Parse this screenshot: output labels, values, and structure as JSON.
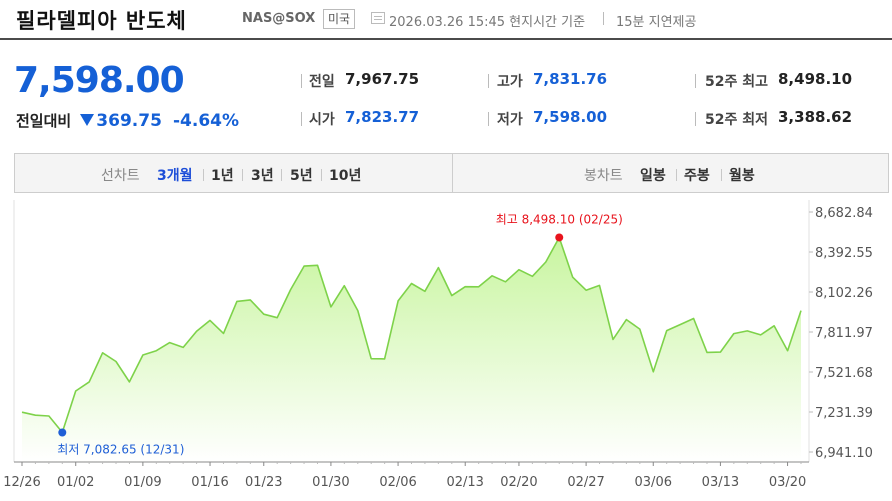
{
  "header": {
    "title": "필라델피아 반도체",
    "code": "NAS@SOX",
    "country": "미국",
    "datetime": "2026.03.26 15:45 현지시간 기준",
    "delay": "15분 지연제공"
  },
  "quote": {
    "price": "7,598.00",
    "change_label": "전일대비",
    "change_value": "369.75",
    "change_percent": "-4.64%",
    "direction": "down",
    "stats": [
      {
        "label": "전일",
        "value": "7,967.75",
        "color": "dark"
      },
      {
        "label": "고가",
        "value": "7,831.76",
        "color": "blue"
      },
      {
        "label": "52주 최고",
        "value": "8,498.10",
        "color": "dark"
      },
      {
        "label": "시가",
        "value": "7,823.77",
        "color": "blue"
      },
      {
        "label": "저가",
        "value": "7,598.00",
        "color": "blue"
      },
      {
        "label": "52주 최저",
        "value": "3,388.62",
        "color": "dark"
      }
    ]
  },
  "tabs": {
    "line_label": "선차트",
    "line_periods": [
      "3개월",
      "1년",
      "3년",
      "5년",
      "10년"
    ],
    "active_period": "3개월",
    "candle_label": "봉차트",
    "candle_periods": [
      "일봉",
      "주봉",
      "월봉"
    ]
  },
  "colors": {
    "accent_blue": "#1560d6",
    "line_green": "#7ed24a",
    "fill_top": "#c8f59f",
    "fill_bottom": "#ffffff",
    "max_marker": "#e8141d",
    "min_marker": "#1f5fd6"
  },
  "chart_data": {
    "type": "area",
    "title": "",
    "xlabel": "",
    "ylabel": "",
    "x_tick_labels": [
      "12/26",
      "01/02",
      "01/09",
      "01/16",
      "01/23",
      "01/30",
      "02/06",
      "02/13",
      "02/20",
      "02/27",
      "03/06",
      "03/13",
      "03/20"
    ],
    "y_tick_labels": [
      "8,682.84",
      "8,392.55",
      "8,102.26",
      "7,811.97",
      "7,521.68",
      "7,231.39",
      "6,941.10"
    ],
    "ylim": [
      6941.1,
      8682.84
    ],
    "x": [
      "12/26",
      "12/29",
      "12/30",
      "12/31",
      "01/02",
      "01/05",
      "01/06",
      "01/07",
      "01/08",
      "01/09",
      "01/12",
      "01/13",
      "01/14",
      "01/15",
      "01/16",
      "01/20",
      "01/21",
      "01/22",
      "01/23",
      "01/26",
      "01/27",
      "01/28",
      "01/29",
      "01/30",
      "02/02",
      "02/03",
      "02/04",
      "02/05",
      "02/06",
      "02/09",
      "02/10",
      "02/11",
      "02/12",
      "02/13",
      "02/17",
      "02/18",
      "02/19",
      "02/20",
      "02/23",
      "02/24",
      "02/25",
      "02/26",
      "02/27",
      "03/02",
      "03/03",
      "03/04",
      "03/05",
      "03/06",
      "03/09",
      "03/10",
      "03/11",
      "03/12",
      "03/13",
      "03/16",
      "03/17",
      "03/18",
      "03/19",
      "03/20",
      "03/26"
    ],
    "series": [
      {
        "values": [
          7230,
          7208,
          7202,
          7083,
          7384,
          7450,
          7661,
          7598,
          7450,
          7645,
          7676,
          7735,
          7700,
          7818,
          7896,
          7802,
          8034,
          8045,
          7941,
          7916,
          8120,
          8290,
          8296,
          7994,
          8148,
          7967,
          7618,
          7617,
          8038,
          8164,
          8107,
          8279,
          8076,
          8141,
          8140,
          8220,
          8176,
          8264,
          8216,
          8320,
          8498,
          8210,
          8115,
          8150,
          7758,
          7902,
          7833,
          7523,
          7822,
          7866,
          7910,
          7664,
          7666,
          7800,
          7820,
          7791,
          7857,
          7676,
          7967
        ]
      }
    ],
    "annotations": {
      "max_label": "최고 8,498.10 (02/25)",
      "max_value": 8498.1,
      "max_date": "02/25",
      "min_label": "최저 7,082.65 (12/31)",
      "min_value": 7082.65,
      "min_date": "12/31"
    },
    "grid": false,
    "legend": "none"
  }
}
